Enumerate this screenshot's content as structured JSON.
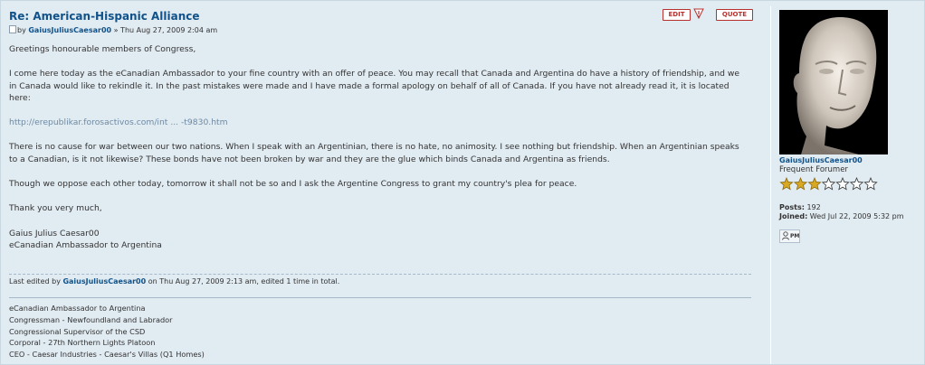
{
  "post": {
    "title": "Re: American-Hispanic Alliance",
    "by_prefix": "by ",
    "author": "GaiusJuliusCaesar00",
    "date": " » Thu Aug 27, 2009 2:04 am",
    "buttons": {
      "edit": "EDIT",
      "quote": "QUOTE"
    },
    "paragraphs": [
      "Greetings honourable members of Congress,",
      "I come here today as the eCanadian Ambassador to your fine country with an offer of peace. You may recall that Canada and Argentina do have a history of friendship, and we in Canada would like to rekindle it. In the past mistakes were made and I have made a formal apology on behalf of all of Canada. If you have not already read it, it is located here:",
      "http://erepublikar.forosactivos.com/int ... -t9830.htm",
      "There is no cause for war between our two nations. When I speak with an Argentinian, there is no hate, no animosity. I see nothing but friendship. When an Argentinian speaks to a Canadian, is it not likewise? These bonds have not been broken by war and they are the glue which binds Canada and Argentina as friends.",
      "Though we oppose each other today, tomorrow it shall not be so and I ask the Argentine Congress to grant my country's plea for peace.",
      "Thank you very much,",
      "Gaius Julius Caesar00\neCanadian Ambassador to Argentina"
    ],
    "edited": {
      "prefix": "Last edited by ",
      "user": "GaiusJuliusCaesar00",
      "suffix": " on Thu Aug 27, 2009 2:13 am, edited 1 time in total."
    },
    "signature": [
      "eCanadian Ambassador to Argentina",
      "Congressman - Newfoundland and Labrador",
      "Congressional Supervisor of the CSD",
      "Corporal - 27th Northern Lights Platoon",
      "CEO - Caesar Industries - Caesar's Villas (Q1 Homes)"
    ]
  },
  "profile": {
    "username": "GaiusJuliusCaesar00",
    "rank": "Frequent Forumer",
    "rank_stars": {
      "filled": 3,
      "total": 7
    },
    "posts_label": "Posts:",
    "posts_value": " 192",
    "joined_label": "Joined:",
    "joined_value": " Wed Jul 22, 2009 5:32 pm",
    "pm_label": "PM"
  },
  "colors": {
    "background": "#e1ebf2",
    "link": "#105289",
    "button_red": "#b7322f",
    "star_gold": "#d9a823",
    "star_empty": "#ffffff"
  },
  "icons": [
    "post-icon",
    "report-icon",
    "pm-icon",
    "rank-star-icon"
  ]
}
